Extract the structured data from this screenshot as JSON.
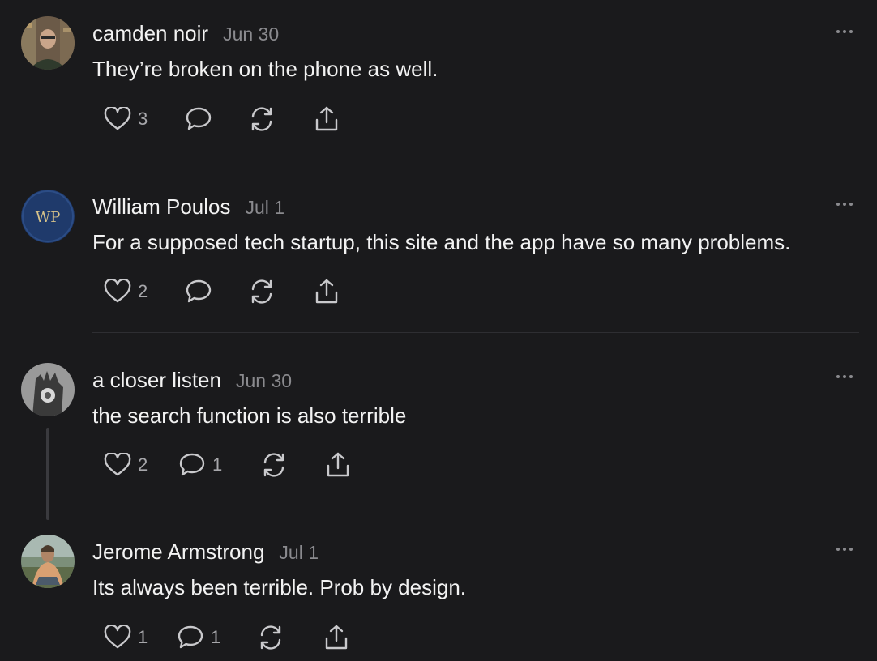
{
  "comments": [
    {
      "author": "camden noir",
      "date": "Jun 30",
      "text": "They’re broken on the phone as well.",
      "likes": "3",
      "replies": ""
    },
    {
      "author": "William Poulos",
      "date": "Jul 1",
      "text": "For a supposed tech startup, this site and the app have so many problems.",
      "avatar_initials": "WP",
      "likes": "2",
      "replies": ""
    },
    {
      "author": "a closer listen",
      "date": "Jun 30",
      "text": "the search function is also terrible",
      "likes": "2",
      "replies": "1"
    },
    {
      "author": "Jerome Armstrong",
      "date": "Jul 1",
      "text": "Its always been terrible. Prob by design.",
      "likes": "1",
      "replies": "1"
    }
  ],
  "colors": {
    "background": "#1a1a1c",
    "text_primary": "#f2f2f2",
    "text_secondary": "#8a8a8e",
    "icon": "#c9c9cc",
    "wp_avatar_bg": "#1f3a6b",
    "wp_avatar_text": "#d8c38a"
  },
  "icons": [
    "heart-icon",
    "comment-icon",
    "restack-icon",
    "share-icon",
    "more-icon"
  ]
}
